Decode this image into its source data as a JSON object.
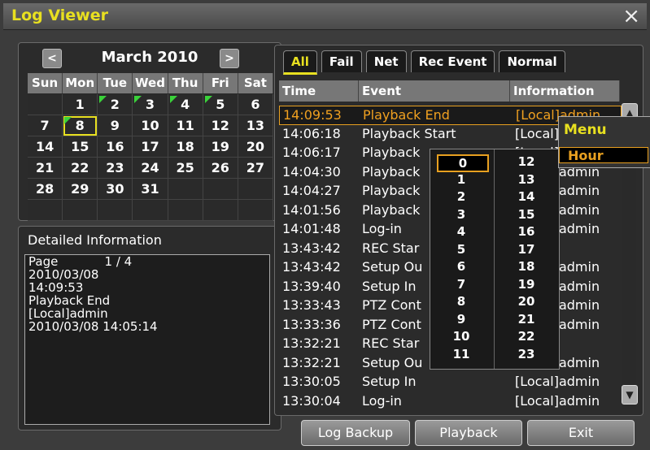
{
  "window": {
    "title": "Log Viewer",
    "close_glyph": "×"
  },
  "calendar": {
    "month_label": "March 2010",
    "prev_glyph": "<",
    "next_glyph": ">",
    "weekdays": [
      "Sun",
      "Mon",
      "Tue",
      "Wed",
      "Thu",
      "Fri",
      "Sat"
    ],
    "weeks": [
      [
        "",
        "1",
        "2",
        "3",
        "4",
        "5",
        "6"
      ],
      [
        "7",
        "8",
        "9",
        "10",
        "11",
        "12",
        "13"
      ],
      [
        "14",
        "15",
        "16",
        "17",
        "18",
        "19",
        "20"
      ],
      [
        "21",
        "22",
        "23",
        "24",
        "25",
        "26",
        "27"
      ],
      [
        "28",
        "29",
        "30",
        "31",
        "",
        "",
        ""
      ],
      [
        "",
        "",
        "",
        "",
        "",
        "",
        ""
      ]
    ],
    "selected_day": "8",
    "days_with_logs": [
      "2",
      "3",
      "4",
      "5",
      "8"
    ]
  },
  "detail": {
    "label": "Detailed Information",
    "lines": [
      "Page            1 / 4",
      "2010/03/08",
      "14:09:53",
      "Playback End",
      "[Local]admin",
      "2010/03/08 14:05:14"
    ]
  },
  "tabs": [
    "All",
    "Fail",
    "Net",
    "Rec Event",
    "Normal"
  ],
  "active_tab": "All",
  "table": {
    "headers": [
      "Time",
      "Event",
      "Information"
    ],
    "rows": [
      [
        "14:09:53",
        "Playback End",
        "[Local]admin"
      ],
      [
        "14:06:18",
        "Playback Start",
        "[Local]admin"
      ],
      [
        "14:06:17",
        "Playback",
        "[Local]admin"
      ],
      [
        "14:04:30",
        "Playback",
        "[Local]admin"
      ],
      [
        "14:04:27",
        "Playback",
        "[Local]admin"
      ],
      [
        "14:01:56",
        "Playback",
        "[Local]admin"
      ],
      [
        "14:01:48",
        "Log-in",
        "[Local]admin"
      ],
      [
        "13:43:42",
        "REC Star",
        ""
      ],
      [
        "13:43:42",
        "Setup Ou",
        "[Local]admin"
      ],
      [
        "13:39:40",
        "Setup In",
        "[Local]admin"
      ],
      [
        "13:33:43",
        "PTZ Cont",
        "[Local]admin"
      ],
      [
        "13:33:36",
        "PTZ Cont",
        "[Local]admin"
      ],
      [
        "13:32:21",
        "REC Star",
        ""
      ],
      [
        "13:32:21",
        "Setup Ou",
        "[Local]admin"
      ],
      [
        "13:30:05",
        "Setup In",
        "[Local]admin"
      ],
      [
        "13:30:04",
        "Log-in",
        "[Local]admin"
      ]
    ]
  },
  "hour_picker": {
    "left": [
      "0",
      "1",
      "2",
      "3",
      "4",
      "5",
      "6",
      "7",
      "8",
      "9",
      "10",
      "11"
    ],
    "right": [
      "12",
      "13",
      "14",
      "15",
      "16",
      "17",
      "18",
      "19",
      "20",
      "21",
      "22",
      "23"
    ],
    "selected": "0"
  },
  "menu": {
    "title": "Menu",
    "item": "Hour"
  },
  "buttons": {
    "backup": "Log Backup",
    "playback": "Playback",
    "exit": "Exit"
  },
  "scroll": {
    "up_icon": "▲",
    "down_icon": "▼"
  },
  "colors": {
    "accent": "#e8e020",
    "highlight": "#e8a020",
    "flag": "#3ad23a"
  }
}
